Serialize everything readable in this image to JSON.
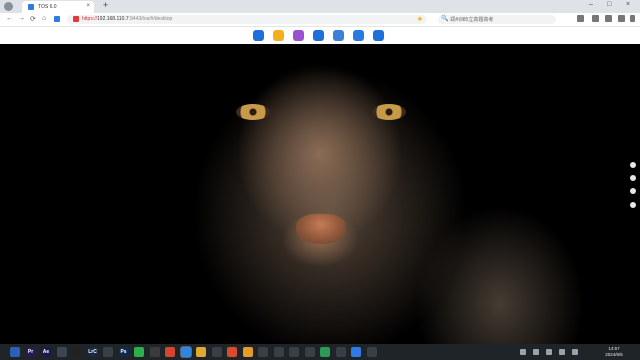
{
  "browser": {
    "tab_title": "TOS 6.0",
    "tab_close": "×",
    "new_tab": "+",
    "window_controls": [
      "–",
      "□",
      "×"
    ],
    "nav_icons": [
      "←",
      "→",
      "⟳",
      "⌂"
    ],
    "url_https": "https://",
    "url_host": "192.168.110.7",
    "url_rest": ":9443/tos/#/desktop",
    "bookmark_star": "★",
    "search_placeholder": "郑州985立高题高考",
    "search_icon": "🔍"
  },
  "dock": {
    "apps": [
      {
        "name": "control-panel-icon",
        "color": "#1e6fd9"
      },
      {
        "name": "file-manager-icon",
        "color": "#f2b01e"
      },
      {
        "name": "media-icon",
        "color": "#9b4fd1"
      },
      {
        "name": "clock-app-icon",
        "color": "#1e6fd9"
      },
      {
        "name": "settings-icon",
        "color": "#3c7fd6"
      },
      {
        "name": "mail-icon",
        "color": "#2a79e0"
      },
      {
        "name": "support-icon",
        "color": "#1e6fd9"
      }
    ]
  },
  "taskbar": {
    "apps": [
      {
        "name": "app-icon",
        "label": "",
        "color": "#2b5fb8"
      },
      {
        "name": "premiere-icon",
        "label": "Pr",
        "color": "#2a1a52"
      },
      {
        "name": "after-effects-icon",
        "label": "Ae",
        "color": "#1d1a4a"
      },
      {
        "name": "app-icon",
        "label": "",
        "color": "#3c4650"
      },
      {
        "name": "capcut-icon",
        "label": "",
        "color": "#222"
      },
      {
        "name": "lrc-icon",
        "label": "LrC",
        "color": "#1a2a44"
      },
      {
        "name": "app-icon",
        "label": "",
        "color": "#3a3f46"
      },
      {
        "name": "photoshop-icon",
        "label": "Ps",
        "color": "#0f2a4a"
      },
      {
        "name": "wechat-icon",
        "label": "",
        "color": "#2db04a"
      },
      {
        "name": "app-icon",
        "label": "",
        "color": "#3b3b3b"
      },
      {
        "name": "chrome-icon",
        "label": "",
        "color": "#d5452f"
      },
      {
        "name": "app-icon",
        "label": "",
        "color": "#2f86e0"
      },
      {
        "name": "chrome-icon",
        "label": "",
        "color": "#e0a82f"
      },
      {
        "name": "app-icon",
        "label": "",
        "color": "#3a3f46"
      },
      {
        "name": "app-icon",
        "label": "",
        "color": "#d94b2b"
      },
      {
        "name": "search-icon",
        "label": "",
        "color": "#e59a2a"
      },
      {
        "name": "app-icon",
        "label": "",
        "color": "#3a3f46"
      },
      {
        "name": "app-icon",
        "label": "",
        "color": "#3a3f46"
      },
      {
        "name": "app-icon",
        "label": "",
        "color": "#3a3f46"
      },
      {
        "name": "app-icon",
        "label": "",
        "color": "#3a3f46"
      },
      {
        "name": "app-icon",
        "label": "",
        "color": "#2e9a5a"
      },
      {
        "name": "app-icon",
        "label": "",
        "color": "#3a3f46"
      },
      {
        "name": "app-icon",
        "label": "",
        "color": "#2f7be5"
      },
      {
        "name": "app-icon",
        "label": "",
        "color": "#3a3f46"
      }
    ],
    "clock_time": "14:57",
    "clock_date": "2024/6/6"
  }
}
